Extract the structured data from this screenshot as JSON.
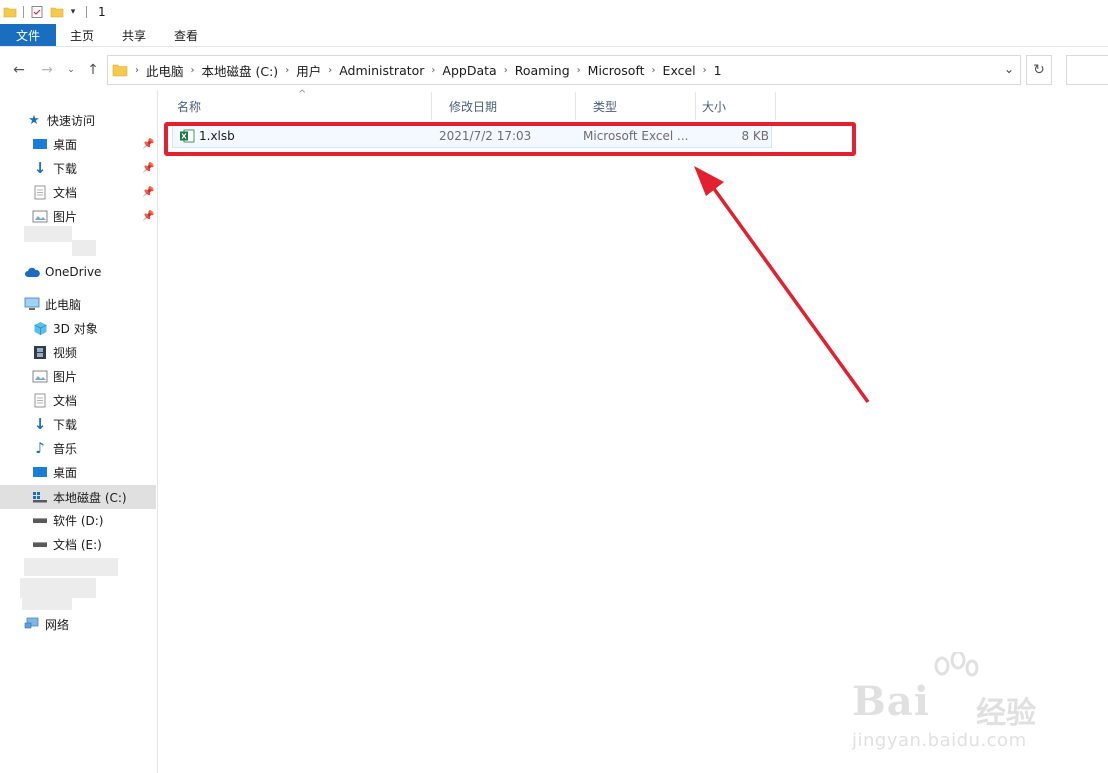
{
  "window": {
    "title": "1"
  },
  "ribbon": {
    "tabs": [
      "文件",
      "主页",
      "共享",
      "查看"
    ]
  },
  "address": {
    "breadcrumbs": [
      "此电脑",
      "本地磁盘 (C:)",
      "用户",
      "Administrator",
      "AppData",
      "Roaming",
      "Microsoft",
      "Excel",
      "1"
    ]
  },
  "sidebar": {
    "quick_access": "快速访问",
    "quick_items": [
      "桌面",
      "下载",
      "文档",
      "图片"
    ],
    "onedrive": "OneDrive",
    "this_pc": "此电脑",
    "pc_items": [
      "3D 对象",
      "视频",
      "图片",
      "文档",
      "下载",
      "音乐",
      "桌面",
      "本地磁盘 (C:)",
      "软件 (D:)",
      "文档 (E:)"
    ],
    "network": "网络"
  },
  "columns": [
    "名称",
    "修改日期",
    "类型",
    "大小"
  ],
  "files": [
    {
      "name": "1.xlsb",
      "modified": "2021/7/2 17:03",
      "type": "Microsoft Excel ...",
      "size": "8 KB"
    }
  ],
  "watermark": {
    "brand": "Bai",
    "brand_suffix": "经验",
    "url": "jingyan.baidu.com"
  },
  "colors": {
    "accent": "#1a6ec0",
    "highlight": "#e3202f",
    "folder": "#f5c94c"
  }
}
